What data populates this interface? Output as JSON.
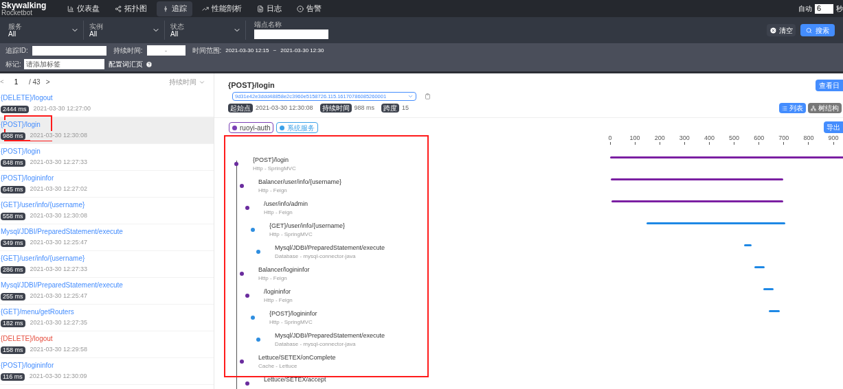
{
  "header": {
    "logo": {
      "title": "Skywalking",
      "subtitle": "Rocketbot"
    },
    "nav": [
      {
        "label": "仪表盘",
        "selected": false
      },
      {
        "label": "拓扑图",
        "selected": false
      },
      {
        "label": "追踪",
        "selected": true
      },
      {
        "label": "性能剖析",
        "selected": false
      },
      {
        "label": "日志",
        "selected": false
      },
      {
        "label": "告警",
        "selected": false
      }
    ],
    "auto_refresh": {
      "label": "自动",
      "value": "6",
      "unit": "秒"
    }
  },
  "filters": {
    "selects": [
      {
        "label": "服务",
        "value": "All"
      },
      {
        "label": "实例",
        "value": "All"
      },
      {
        "label": "状态",
        "value": "All"
      }
    ],
    "endpoint": {
      "label": "端点名称"
    },
    "buttons": [
      {
        "label": "清空",
        "kind": "clear"
      },
      {
        "label": "搜索",
        "kind": "search"
      }
    ]
  },
  "advanced": {
    "trace_id": {
      "label": "追踪ID:"
    },
    "duration": {
      "label": "持续时间:",
      "placeholder": "-"
    },
    "time_range": {
      "label": "时间范围:",
      "start": "2021-03-30 12:15",
      "separator": "~",
      "end": "2021-03-30 12:30"
    },
    "tags": {
      "label": "标记:",
      "placeholder": "请添加标签"
    },
    "vocab_link": "配置词汇页"
  },
  "trace_list": {
    "pagination": {
      "prev": "<",
      "page": "1",
      "total": "/ 43",
      "next": ">"
    },
    "sort": "持续时间",
    "items": [
      {
        "endpoint": "{DELETE}/logout",
        "duration": "2444 ms",
        "start": "2021-03-30 12:27:00",
        "error": false,
        "selected": false
      },
      {
        "endpoint": "{POST}/login",
        "duration": "988 ms",
        "start": "2021-03-30 12:30:08",
        "error": false,
        "selected": true
      },
      {
        "endpoint": "{POST}/login",
        "duration": "848 ms",
        "start": "2021-03-30 12:27:33",
        "error": false,
        "selected": false
      },
      {
        "endpoint": "{POST}/logininfor",
        "duration": "645 ms",
        "start": "2021-03-30 12:27:02",
        "error": false,
        "selected": false
      },
      {
        "endpoint": "{GET}/user/info/{username}",
        "duration": "558 ms",
        "start": "2021-03-30 12:30:08",
        "error": false,
        "selected": false
      },
      {
        "endpoint": "Mysql/JDBI/PreparedStatement/execute",
        "duration": "349 ms",
        "start": "2021-03-30 12:25:47",
        "error": false,
        "selected": false
      },
      {
        "endpoint": "{GET}/user/info/{username}",
        "duration": "286 ms",
        "start": "2021-03-30 12:27:33",
        "error": false,
        "selected": false
      },
      {
        "endpoint": "Mysql/JDBI/PreparedStatement/execute",
        "duration": "255 ms",
        "start": "2021-03-30 12:25:47",
        "error": false,
        "selected": false
      },
      {
        "endpoint": "{GET}/menu/getRouters",
        "duration": "182 ms",
        "start": "2021-03-30 12:27:35",
        "error": false,
        "selected": false
      },
      {
        "endpoint": "{DELETE}/logout",
        "duration": "158 ms",
        "start": "2021-03-30 12:29:58",
        "error": true,
        "selected": false
      },
      {
        "endpoint": "{POST}/logininfor",
        "duration": "116 ms",
        "start": "2021-03-30 12:30:09",
        "error": false,
        "selected": false
      }
    ]
  },
  "trace_detail": {
    "title": "{POST}/login",
    "log_button": "查看日",
    "trace_id": "9d31e42e3ddd48858e2c3960e5158726.115.16170786085260001",
    "meta": [
      {
        "label": "起始点",
        "value": "2021-03-30 12:30:08"
      },
      {
        "label": "持续时间",
        "value": "988 ms"
      },
      {
        "label": "跨度",
        "value": "15"
      }
    ],
    "views": [
      {
        "label": "列表",
        "selected": true
      },
      {
        "label": "树结构",
        "selected": false
      }
    ],
    "services": [
      {
        "name": "ruoyi-auth",
        "color": "#7b3fb5"
      },
      {
        "name": "系统服务",
        "color": "#3ba1e8"
      }
    ],
    "export_button": "导出",
    "spans": [
      {
        "title": "{POST}/login",
        "subtitle": "Http - SpringMVC",
        "color": "#6a2c9e",
        "children": [
          {
            "title": "Balancer/user/info/{username}",
            "subtitle": "Http - Feign",
            "color": "#6a2c9e",
            "children": [
              {
                "title": "/user/info/admin",
                "subtitle": "Http - Feign",
                "color": "#6a2c9e",
                "children": [
                  {
                    "title": "{GET}/user/info/{username}",
                    "subtitle": "Http - SpringMVC",
                    "color": "#2f8ee0",
                    "children": [
                      {
                        "title": "Mysql/JDBI/PreparedStatement/execute",
                        "subtitle": "Database - mysql-connector-java",
                        "color": "#2f8ee0"
                      }
                    ]
                  }
                ]
              }
            ]
          },
          {
            "title": "Balancer/logininfor",
            "subtitle": "Http - Feign",
            "color": "#6a2c9e",
            "children": [
              {
                "title": "/logininfor",
                "subtitle": "Http - Feign",
                "color": "#6a2c9e",
                "children": [
                  {
                    "title": "{POST}/logininfor",
                    "subtitle": "Http - SpringMVC",
                    "color": "#2f8ee0",
                    "children": [
                      {
                        "title": "Mysql/JDBI/PreparedStatement/execute",
                        "subtitle": "Database - mysql-connector-java",
                        "color": "#2f8ee0"
                      }
                    ]
                  }
                ]
              }
            ]
          },
          {
            "title": "Lettuce/SETEX/onComplete",
            "subtitle": "Cache - Lettuce",
            "color": "#6a2c9e",
            "children": [
              {
                "title": "Lettuce/SETEX/accept",
                "color": "#6a2c9e"
              }
            ]
          }
        ]
      }
    ],
    "timeline_ticks": [
      "0",
      "100",
      "200",
      "300",
      "400",
      "500",
      "600",
      "700",
      "800",
      "900"
    ]
  }
}
